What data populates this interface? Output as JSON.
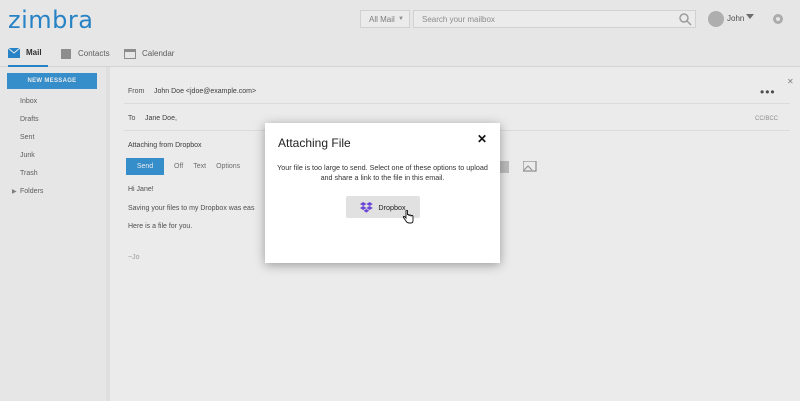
{
  "header": {
    "logo": "zimbra",
    "search_scope": "All Mail",
    "search_placeholder": "Search your mailbox",
    "user": "John"
  },
  "nav": {
    "tabs": [
      {
        "label": "Mail",
        "icon": "mail-icon",
        "active": true
      },
      {
        "label": "Contacts",
        "icon": "contacts-icon",
        "active": false
      },
      {
        "label": "Calendar",
        "icon": "calendar-icon",
        "active": false
      }
    ]
  },
  "sidebar": {
    "new_message_label": "NEW MESSAGE",
    "folders": [
      "Inbox",
      "Drafts",
      "Sent",
      "Junk",
      "Trash",
      "Folders"
    ]
  },
  "compose": {
    "from_label": "From",
    "from_value": "John Doe <jdoe@example.com>",
    "to_label": "To",
    "to_value": "Jane Doe,",
    "cc_link": "CC/BCC",
    "subject": "Attaching from Dropbox",
    "toolbar": {
      "send": "Send",
      "btn1": "Off",
      "btn2": "Text",
      "btn3": "Options"
    },
    "body_lines": [
      "Hi Jane!",
      "Saving your files to my Dropbox was eas",
      "Here is a file for you.",
      "~Jo"
    ]
  },
  "dialog": {
    "title": "Attaching File",
    "message": "Your file is too large to send. Select one of these options to upload and share a link to the file in this email.",
    "button_label": "Dropbox"
  },
  "colors": {
    "accent": "#2b8fd6",
    "dropbox": "#6b47d6",
    "dialog_button_bg": "#e1e1e1"
  }
}
